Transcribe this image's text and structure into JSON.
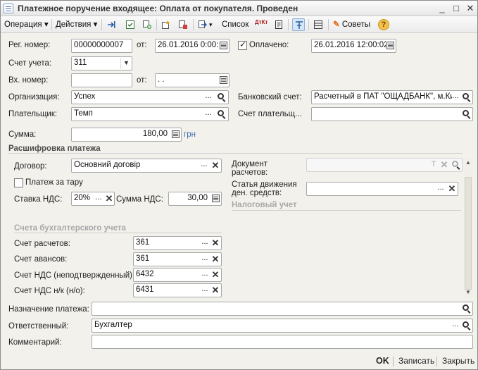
{
  "window": {
    "title": "Платежное поручение входящее: Оплата от покупателя. Проведен",
    "minimize": "_",
    "maximize": "□",
    "close": "✕"
  },
  "toolbar": {
    "operation": "Операция",
    "actions": "Действия",
    "list": "Список",
    "dtkt": "ДтКт",
    "advice": "Советы",
    "help": "?"
  },
  "header": {
    "reg_number_label": "Рег. номер:",
    "reg_number": "00000000007",
    "from_label": "от:",
    "reg_date": "26.01.2016  0:00:",
    "paid_label": "Оплачено:",
    "paid_date": "26.01.2016 12:00:02",
    "account_label": "Счет учета:",
    "account": "311",
    "in_number_label": "Вх. номер:",
    "in_number": "",
    "in_from_label": "от:",
    "in_date": " .  .",
    "org_label": "Организация:",
    "org": "Успех",
    "bank_label": "Банковский счет:",
    "bank": "Расчетный в ПАТ \"ОЩАДБАНК\", м.Ки",
    "payer_label": "Плательщик:",
    "payer": "Темп",
    "payer_account_label": "Счет плательщ...",
    "payer_account": "",
    "sum_label": "Сумма:",
    "sum": "180,00",
    "currency": "грн"
  },
  "details": {
    "title": "Расшифровка платежа",
    "contract_label": "Договор:",
    "contract": "Основний договір",
    "tare_label": "Платеж за тару",
    "vat_rate_label": "Ставка НДС:",
    "vat_rate": "20%",
    "vat_sum_label": "Сумма НДС:",
    "vat_sum": "30,00",
    "settlement_doc_label_1": "Документ",
    "settlement_doc_label_2": "расчетов:",
    "settlement_doc": "",
    "cashflow_label_1": "Статья движения",
    "cashflow_label_2": "ден. средств:",
    "cashflow": "",
    "tax_title": "Налоговый учет",
    "accounts_title": "Счета бухгалтерского учета",
    "acc_settle_label": "Счет расчетов:",
    "acc_settle": "361",
    "acc_adv_label": "Счет авансов:",
    "acc_adv": "361",
    "acc_vat_label": "Счет НДС (неподтвержденный):",
    "acc_vat": "6432",
    "acc_vat_no_label": "Счет НДС н/к (н/о):",
    "acc_vat_no": "6431"
  },
  "footer": {
    "purpose_label": "Назначение платежа:",
    "purpose": "",
    "responsible_label": "Ответственный:",
    "responsible": "Бухгалтер",
    "comment_label": "Комментарий:",
    "comment": "",
    "ok": "OK",
    "save": "Записать",
    "close": "Закрыть"
  }
}
